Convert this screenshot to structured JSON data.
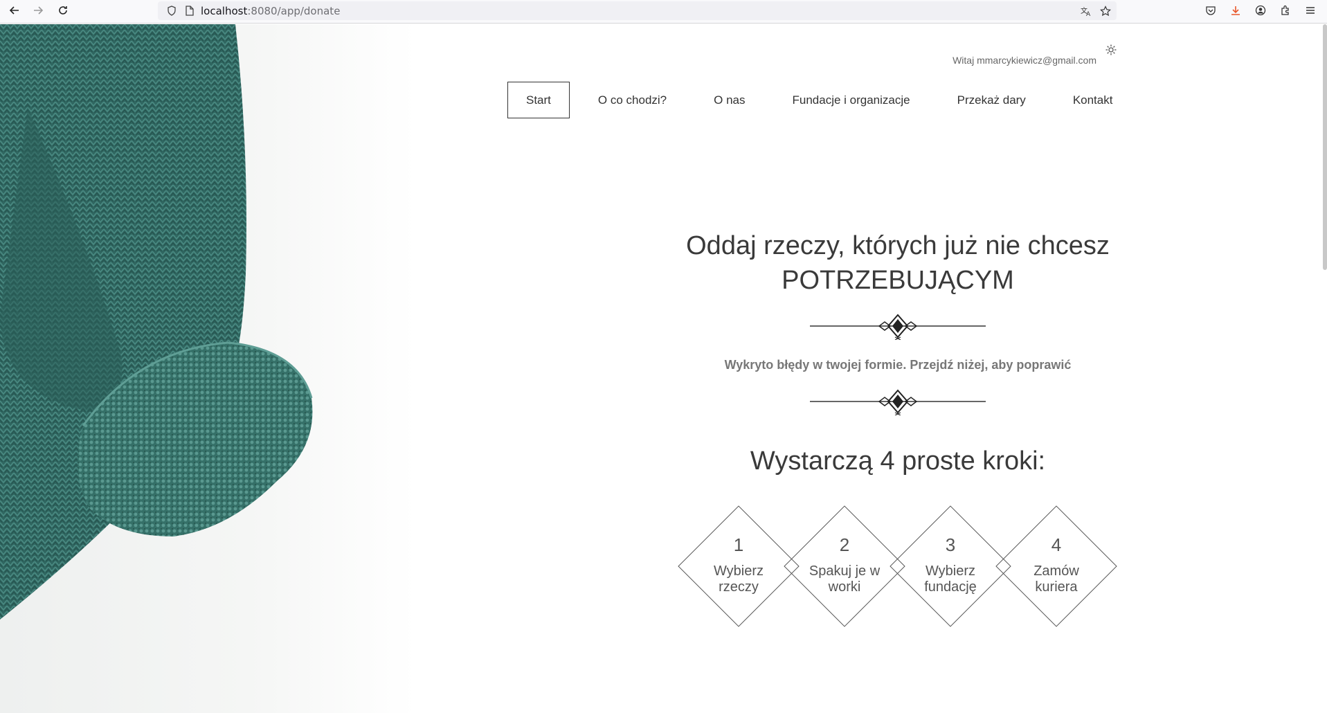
{
  "browser": {
    "url_host": "localhost",
    "url_rest": ":8080/app/donate"
  },
  "header": {
    "greeting": "Witaj mmarcykiewicz@gmail.com",
    "menu": [
      {
        "label": "Start"
      },
      {
        "label": "O co chodzi?"
      },
      {
        "label": "O nas"
      },
      {
        "label": "Fundacje i organizacje"
      },
      {
        "label": "Przekaż dary"
      },
      {
        "label": "Kontakt"
      }
    ]
  },
  "hero": {
    "headline_line1": "Oddaj rzeczy, których już nie chcesz",
    "headline_line2": "POTRZEBUJĄCYM",
    "error_message": "Wykryto błędy w twojej formie. Przejdź niżej, aby poprawić",
    "steps_title": "Wystarczą 4 proste kroki:",
    "steps": [
      {
        "number": "1",
        "line1": "Wybierz",
        "line2": "rzeczy"
      },
      {
        "number": "2",
        "line1": "Spakuj je w",
        "line2": "worki"
      },
      {
        "number": "3",
        "line1": "Wybierz",
        "line2": "fundację"
      },
      {
        "number": "4",
        "line1": "Zamów",
        "line2": "kuriera"
      }
    ]
  },
  "colors": {
    "sweater": "#2f6660",
    "accent_download": "#e8572b"
  }
}
